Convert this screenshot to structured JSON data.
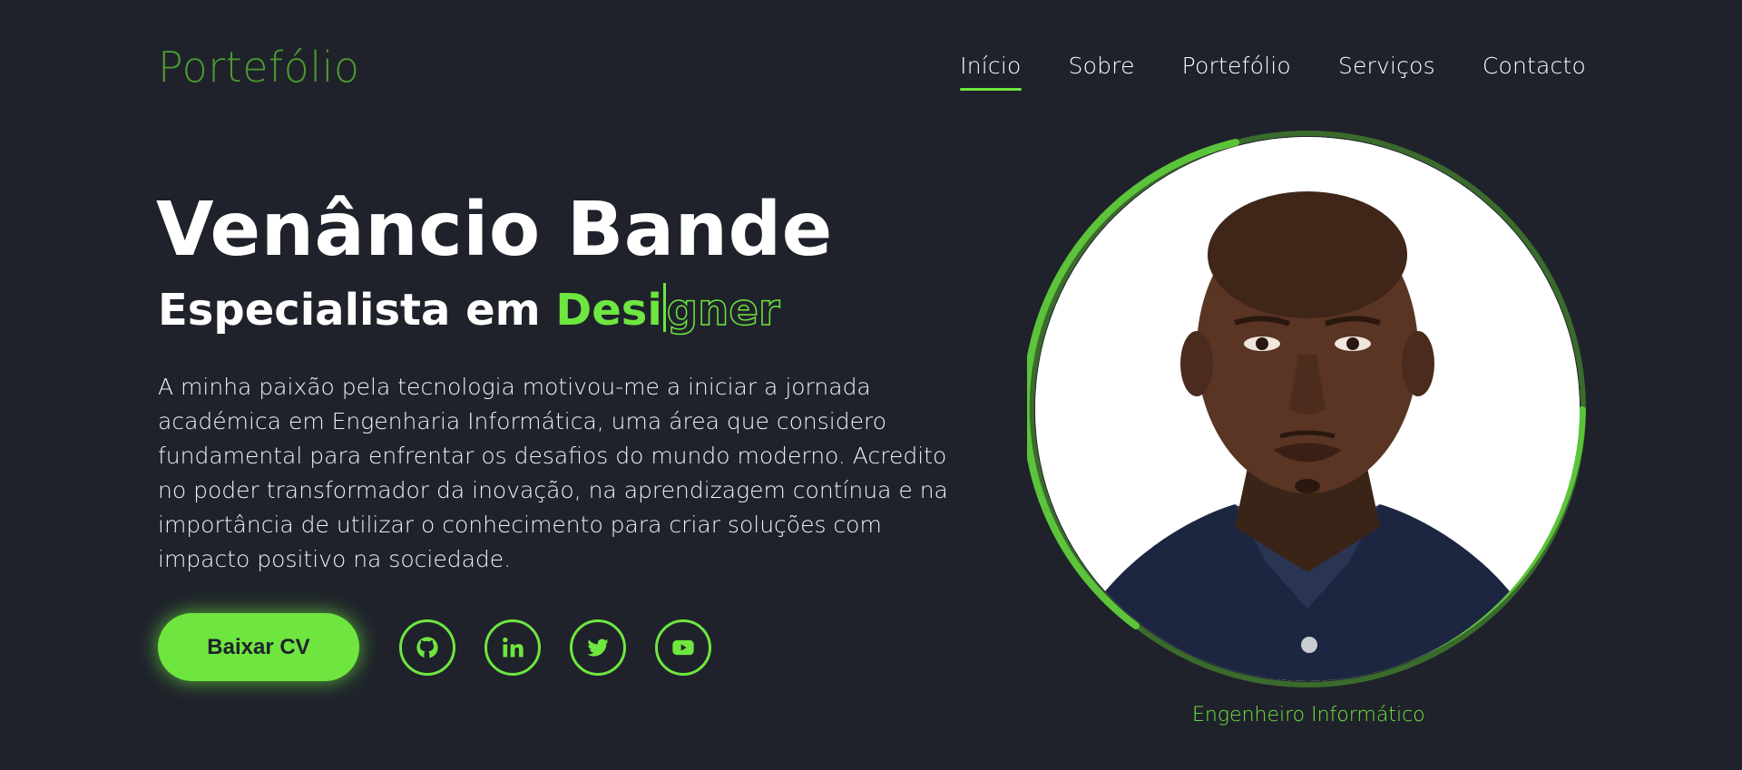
{
  "header": {
    "logo": "Portefólio",
    "nav": [
      {
        "label": "Início",
        "active": true
      },
      {
        "label": "Sobre",
        "active": false
      },
      {
        "label": "Portefólio",
        "active": false
      },
      {
        "label": "Serviços",
        "active": false
      },
      {
        "label": "Contacto",
        "active": false
      }
    ]
  },
  "hero": {
    "name": "Venâncio Bande",
    "role_prefix": "Especialista em ",
    "role_typed": "Desi",
    "role_outline": "gner",
    "description": "A minha paixão pela tecnologia motivou-me a iniciar a jornada académica em Engenharia Informática, uma área que considero fundamental para enfrentar os desafios do mundo moderno. Acredito no poder transformador da inovação, na aprendizagem contínua e na importância de utilizar o conhecimento para criar soluções com impacto positivo na sociedade.",
    "cta_label": "Baixar CV",
    "socials": [
      "github-icon",
      "linkedin-icon",
      "twitter-icon",
      "youtube-icon"
    ]
  },
  "profile": {
    "caption": "Engenheiro Informático"
  },
  "colors": {
    "background": "#1f222b",
    "accent": "#6ee63f",
    "logo": "#4c9a2e"
  }
}
